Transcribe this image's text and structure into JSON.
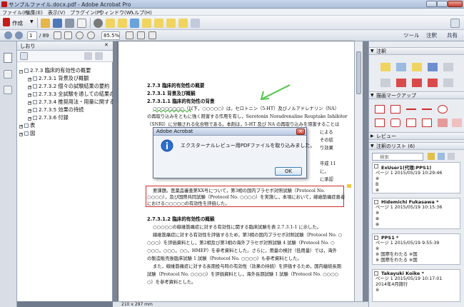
{
  "window": {
    "title": "サンプルファイル.docx.pdf - Adobe Acrobat Pro"
  },
  "menu": [
    "ファイル(F)",
    "編集(E)",
    "表示(V)",
    "プラグイン(P)",
    "ウィンドウ(W)",
    "ヘルプ(H)"
  ],
  "toolbar": {
    "create_label": "作成",
    "page_current": "1",
    "page_total": "/ 89",
    "zoom": "85.5%",
    "tools_label": "ツール",
    "comment_label": "注釈",
    "share_label": "共有"
  },
  "nav": {
    "title": "しおり",
    "bookmarks": [
      {
        "level": 0,
        "text": "2.7.3 臨床的有効性の概要"
      },
      {
        "level": 1,
        "text": "2.7.3.1 背景及び概観"
      },
      {
        "level": 1,
        "text": "2.7.3.2 個々の試験結果の要約"
      },
      {
        "level": 1,
        "text": "2.7.3.3 全試験を通しての結果の比"
      },
      {
        "level": 1,
        "text": "2.7.3.4 推奨用法・用量に関する臨"
      },
      {
        "level": 1,
        "text": "2.7.3.5 効果の持続"
      },
      {
        "level": 1,
        "text": "2.7.3.6 付録"
      },
      {
        "level": 0,
        "text": "表"
      },
      {
        "level": 0,
        "text": "図"
      }
    ]
  },
  "document": {
    "h1": "2.7.3 臨床的有効性の概要",
    "h2": "2.7.3.1 背景及び概観",
    "h3": "2.7.3.1.1 臨床的有効性の背景",
    "p1": [
      "○○○○○○○○（以下，○○○○○）は，セロトニン（5-HT）及びノルアドレナリン（NA）",
      "の再取り込みをともに強く阻害する作用を有し，Serotonin Noradrenaline Reuptake Inhibitor",
      "（SNRI）に分類される化合物である。本剤は，5-HT 及び NA の再取り込みを阻害することは"
    ],
    "p1_right": [
      "による",
      "その結",
      "り効果",
      "平成 11",
      "に，",
      "に承認"
    ],
    "boxed": [
      "要課題。医薬品審査第XX号について，第3相の国内プラセボ対照試験（Protocol No.",
      "○○○○），及び国際共同試験（Protocol No. ○○○○）を実施し，本項において，線維筋痛症患者",
      "における○○○○○の有効性を評価した。"
    ],
    "h4": "2.7.3.1.2 臨床的有効性の概観",
    "p2": [
      "○○○○○の線維筋痛症に対する有効性に関する臨床試験を表 2.7.3.1-1 に示した。",
      "線維筋痛症に対する有効性を評価するため，第3相の国内プラセボ対照試験（Protocol No. ○",
      "○○○）を評価資料とし，第2相及び第3相の海外プラセボ対照試験 4 試験（Protocol No. ○",
      "○○○，○○○，○○，HMEP）を参考資料とした。さらに，用量の検討（低用量）では，海外",
      "の製造販売後臨床試験 1 試験（Protocol No. ○○○○）も参考資料とした。",
      "また，線維筋痛症に対する長期投与時の有効性（効果の持続）を評価するため，国内継続長期",
      "試験（Protocol No. ○○○○）を評価資料とし，海外長期試験 1 試験（Protocol No. ○○○○",
      "○）を参考資料とした。"
    ],
    "page_size": "210 x 297 mm"
  },
  "dialog": {
    "title": "Adobe Acrobat",
    "message": "エクスターナルレビュー用PDFファイルを取り込みました。",
    "ok": "OK"
  },
  "comments_pane": {
    "section_annot": "注釈",
    "section_draw": "描画マークアップ",
    "section_review": "レビュー",
    "section_list": "注釈のリスト (6)",
    "search_placeholder": "検索",
    "items": [
      {
        "author": "ExUser1(代理:PPS1)",
        "page": "ページ 1  2015/05/19 10:29:46",
        "lines": [
          "※",
          "B",
          "⊕"
        ]
      },
      {
        "author": "Hidemichi Fukasawa *",
        "page": "ページ 1  2015/05/19 10:15:36",
        "lines": [
          "※",
          "⊕",
          "⊕"
        ]
      },
      {
        "author": "PPS1 *",
        "page": "ページ 1  2015/05/19 9:55:39",
        "lines": [
          "※",
          "※ 国際をわたる ※国",
          "※ 国際をわたる ※国"
        ]
      },
      {
        "author": "Takayuki Koike *",
        "page": "ページ 1  2015/05/19 10:17:01",
        "lines": [
          "2014年4月施行",
          "※"
        ]
      }
    ]
  },
  "colors": {
    "accent_green": "#2a9a2a",
    "box_red": "#d22a2a",
    "chrome_blue": "#aebfd8"
  }
}
